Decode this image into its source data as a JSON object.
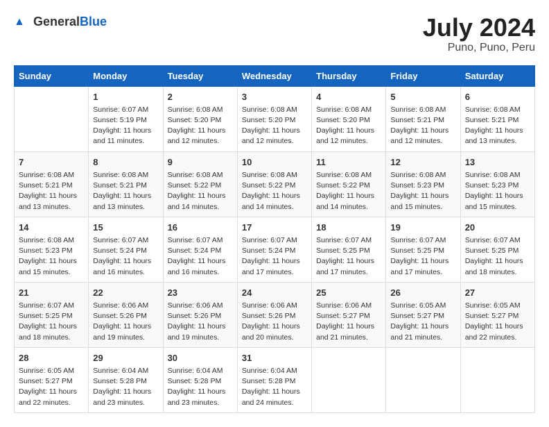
{
  "header": {
    "logo_general": "General",
    "logo_blue": "Blue",
    "month_year": "July 2024",
    "location": "Puno, Puno, Peru"
  },
  "days_of_week": [
    "Sunday",
    "Monday",
    "Tuesday",
    "Wednesday",
    "Thursday",
    "Friday",
    "Saturday"
  ],
  "weeks": [
    [
      {
        "day": "",
        "info": ""
      },
      {
        "day": "1",
        "info": "Sunrise: 6:07 AM\nSunset: 5:19 PM\nDaylight: 11 hours\nand 11 minutes."
      },
      {
        "day": "2",
        "info": "Sunrise: 6:08 AM\nSunset: 5:20 PM\nDaylight: 11 hours\nand 12 minutes."
      },
      {
        "day": "3",
        "info": "Sunrise: 6:08 AM\nSunset: 5:20 PM\nDaylight: 11 hours\nand 12 minutes."
      },
      {
        "day": "4",
        "info": "Sunrise: 6:08 AM\nSunset: 5:20 PM\nDaylight: 11 hours\nand 12 minutes."
      },
      {
        "day": "5",
        "info": "Sunrise: 6:08 AM\nSunset: 5:21 PM\nDaylight: 11 hours\nand 12 minutes."
      },
      {
        "day": "6",
        "info": "Sunrise: 6:08 AM\nSunset: 5:21 PM\nDaylight: 11 hours\nand 13 minutes."
      }
    ],
    [
      {
        "day": "7",
        "info": "Sunrise: 6:08 AM\nSunset: 5:21 PM\nDaylight: 11 hours\nand 13 minutes."
      },
      {
        "day": "8",
        "info": "Sunrise: 6:08 AM\nSunset: 5:21 PM\nDaylight: 11 hours\nand 13 minutes."
      },
      {
        "day": "9",
        "info": "Sunrise: 6:08 AM\nSunset: 5:22 PM\nDaylight: 11 hours\nand 14 minutes."
      },
      {
        "day": "10",
        "info": "Sunrise: 6:08 AM\nSunset: 5:22 PM\nDaylight: 11 hours\nand 14 minutes."
      },
      {
        "day": "11",
        "info": "Sunrise: 6:08 AM\nSunset: 5:22 PM\nDaylight: 11 hours\nand 14 minutes."
      },
      {
        "day": "12",
        "info": "Sunrise: 6:08 AM\nSunset: 5:23 PM\nDaylight: 11 hours\nand 15 minutes."
      },
      {
        "day": "13",
        "info": "Sunrise: 6:08 AM\nSunset: 5:23 PM\nDaylight: 11 hours\nand 15 minutes."
      }
    ],
    [
      {
        "day": "14",
        "info": "Sunrise: 6:08 AM\nSunset: 5:23 PM\nDaylight: 11 hours\nand 15 minutes."
      },
      {
        "day": "15",
        "info": "Sunrise: 6:07 AM\nSunset: 5:24 PM\nDaylight: 11 hours\nand 16 minutes."
      },
      {
        "day": "16",
        "info": "Sunrise: 6:07 AM\nSunset: 5:24 PM\nDaylight: 11 hours\nand 16 minutes."
      },
      {
        "day": "17",
        "info": "Sunrise: 6:07 AM\nSunset: 5:24 PM\nDaylight: 11 hours\nand 17 minutes."
      },
      {
        "day": "18",
        "info": "Sunrise: 6:07 AM\nSunset: 5:25 PM\nDaylight: 11 hours\nand 17 minutes."
      },
      {
        "day": "19",
        "info": "Sunrise: 6:07 AM\nSunset: 5:25 PM\nDaylight: 11 hours\nand 17 minutes."
      },
      {
        "day": "20",
        "info": "Sunrise: 6:07 AM\nSunset: 5:25 PM\nDaylight: 11 hours\nand 18 minutes."
      }
    ],
    [
      {
        "day": "21",
        "info": "Sunrise: 6:07 AM\nSunset: 5:25 PM\nDaylight: 11 hours\nand 18 minutes."
      },
      {
        "day": "22",
        "info": "Sunrise: 6:06 AM\nSunset: 5:26 PM\nDaylight: 11 hours\nand 19 minutes."
      },
      {
        "day": "23",
        "info": "Sunrise: 6:06 AM\nSunset: 5:26 PM\nDaylight: 11 hours\nand 19 minutes."
      },
      {
        "day": "24",
        "info": "Sunrise: 6:06 AM\nSunset: 5:26 PM\nDaylight: 11 hours\nand 20 minutes."
      },
      {
        "day": "25",
        "info": "Sunrise: 6:06 AM\nSunset: 5:27 PM\nDaylight: 11 hours\nand 21 minutes."
      },
      {
        "day": "26",
        "info": "Sunrise: 6:05 AM\nSunset: 5:27 PM\nDaylight: 11 hours\nand 21 minutes."
      },
      {
        "day": "27",
        "info": "Sunrise: 6:05 AM\nSunset: 5:27 PM\nDaylight: 11 hours\nand 22 minutes."
      }
    ],
    [
      {
        "day": "28",
        "info": "Sunrise: 6:05 AM\nSunset: 5:27 PM\nDaylight: 11 hours\nand 22 minutes."
      },
      {
        "day": "29",
        "info": "Sunrise: 6:04 AM\nSunset: 5:28 PM\nDaylight: 11 hours\nand 23 minutes."
      },
      {
        "day": "30",
        "info": "Sunrise: 6:04 AM\nSunset: 5:28 PM\nDaylight: 11 hours\nand 23 minutes."
      },
      {
        "day": "31",
        "info": "Sunrise: 6:04 AM\nSunset: 5:28 PM\nDaylight: 11 hours\nand 24 minutes."
      },
      {
        "day": "",
        "info": ""
      },
      {
        "day": "",
        "info": ""
      },
      {
        "day": "",
        "info": ""
      }
    ]
  ]
}
